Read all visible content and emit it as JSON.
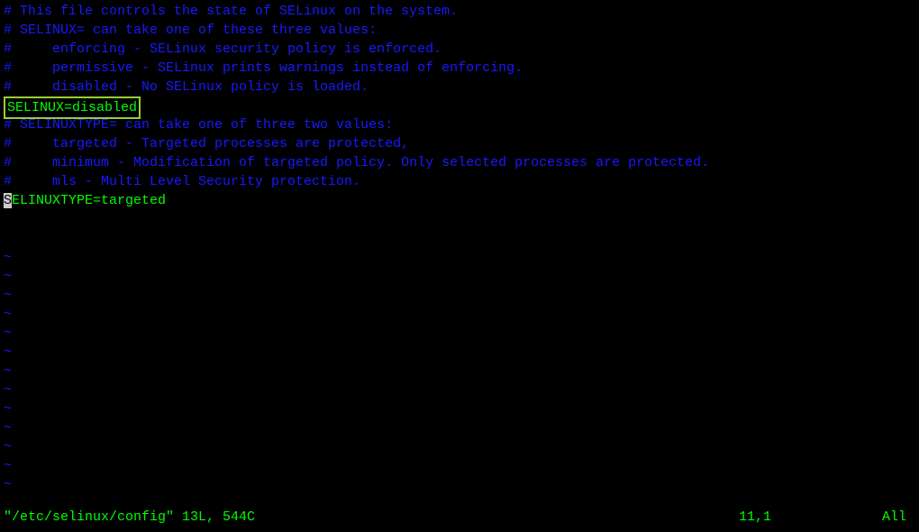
{
  "editor": {
    "lines": {
      "l1": "# This file controls the state of SELinux on the system.",
      "l2": "# SELINUX= can take one of these three values:",
      "l3": "#     enforcing - SELinux security policy is enforced.",
      "l4": "#     permissive - SELinux prints warnings instead of enforcing.",
      "l5": "#     disabled - No SELinux policy is loaded.",
      "l6": "SELINUX=disabled",
      "l7": "# SELINUXTYPE= can take one of three two values:",
      "l8": "#     targeted - Targeted processes are protected,",
      "l9": "#     minimum - Modification of targeted policy. Only selected processes are protected.",
      "l10": "#     mls - Multi Level Security protection.",
      "l11_cursor": "S",
      "l11_rest": "ELINUXTYPE=targeted"
    },
    "tilde": "~"
  },
  "status": {
    "file": "\"/etc/selinux/config\" 13L, 544C",
    "position": "11,1",
    "view": "All"
  }
}
